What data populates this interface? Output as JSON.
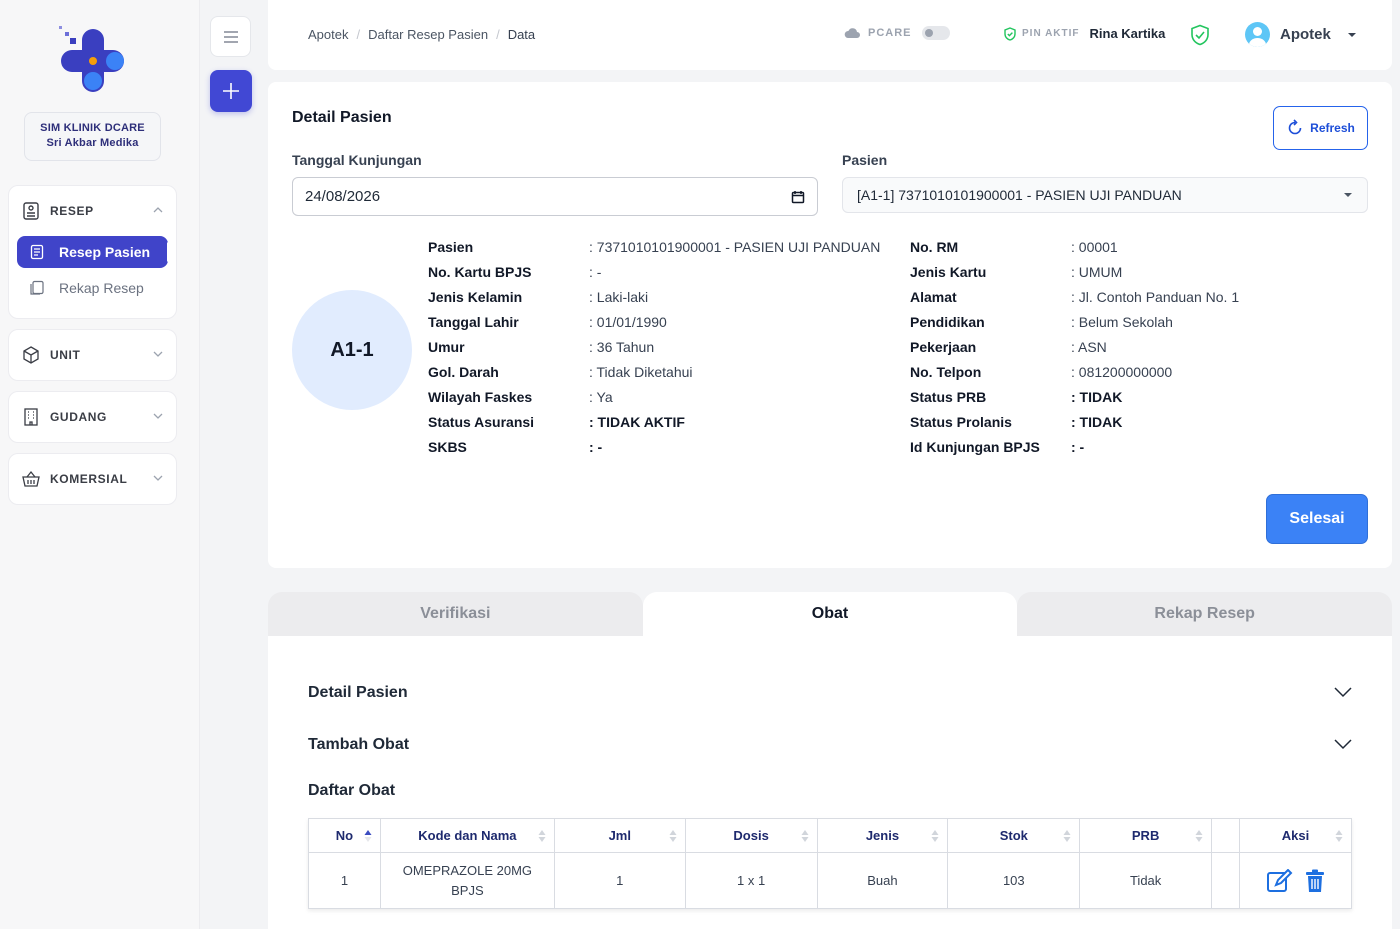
{
  "clinic": {
    "line1": "SIM KLINIK DCARE",
    "line2": "Sri Akbar Medika"
  },
  "sidebar": {
    "resep": {
      "label": "RESEP",
      "items": [
        {
          "label": "Resep Pasien",
          "active": true
        },
        {
          "label": "Rekap Resep",
          "active": false
        }
      ]
    },
    "unit": {
      "label": "UNIT"
    },
    "gudang": {
      "label": "GUDANG"
    },
    "komersial": {
      "label": "KOMERSIAL"
    }
  },
  "breadcrumb": {
    "item1": "Apotek",
    "item2": "Daftar Resep Pasien",
    "item3": "Data"
  },
  "topbar": {
    "pcare_label": "PCARE",
    "pin_label": "PIN AKTIF",
    "pin_name": "Rina Kartika",
    "user_name": "Apotek"
  },
  "detail": {
    "title": "Detail Pasien",
    "refresh_label": "Refresh",
    "tanggal_label": "Tanggal Kunjungan",
    "tanggal_value": "24/08/2026",
    "pasien_label": "Pasien",
    "pasien_value": "[A1-1] 7371010101900001 - PASIEN UJI PANDUAN",
    "queue_code": "A1-1",
    "left": [
      {
        "k": "Pasien",
        "v": ": 7371010101900001 - PASIEN UJI PANDUAN",
        "bold": false
      },
      {
        "k": "No. Kartu BPJS",
        "v": ": -",
        "bold": false
      },
      {
        "k": "Jenis Kelamin",
        "v": ": Laki-laki",
        "bold": false
      },
      {
        "k": "Tanggal Lahir",
        "v": ": 01/01/1990",
        "bold": false
      },
      {
        "k": "Umur",
        "v": ": 36 Tahun",
        "bold": false
      },
      {
        "k": "Gol. Darah",
        "v": ": Tidak Diketahui",
        "bold": false
      },
      {
        "k": "Wilayah Faskes",
        "v": ": Ya",
        "bold": false
      },
      {
        "k": "Status Asuransi",
        "v": ": TIDAK AKTIF",
        "bold": true
      },
      {
        "k": "SKBS",
        "v": ": -",
        "bold": true
      }
    ],
    "right": [
      {
        "k": "No. RM",
        "v": ": 00001",
        "bold": false
      },
      {
        "k": "Jenis Kartu",
        "v": ": UMUM",
        "bold": false
      },
      {
        "k": "Alamat",
        "v": ": Jl. Contoh Panduan No. 1",
        "bold": false
      },
      {
        "k": "Pendidikan",
        "v": ": Belum Sekolah",
        "bold": false
      },
      {
        "k": "Pekerjaan",
        "v": ": ASN",
        "bold": false
      },
      {
        "k": "No. Telpon",
        "v": ": 081200000000",
        "bold": false
      },
      {
        "k": "Status PRB",
        "v": ": TIDAK",
        "bold": true
      },
      {
        "k": "Status Prolanis",
        "v": ": TIDAK",
        "bold": true
      },
      {
        "k": "Id Kunjungan BPJS",
        "v": ": -",
        "bold": true
      }
    ],
    "selesai_label": "Selesai"
  },
  "tabs": [
    {
      "label": "Verifikasi",
      "active": false
    },
    {
      "label": "Obat",
      "active": true
    },
    {
      "label": "Rekap Resep",
      "active": false
    }
  ],
  "obat": {
    "acc1": "Detail Pasien",
    "acc2": "Tambah Obat",
    "list_title": "Daftar Obat",
    "columns": [
      "No",
      "Kode dan Nama",
      "Jml",
      "Dosis",
      "Jenis",
      "Stok",
      "PRB",
      "",
      "Aksi"
    ],
    "rows": [
      {
        "no": "1",
        "nama": "OMEPRAZOLE 20MG BPJS",
        "jml": "1",
        "dosis": "1 x 1",
        "jenis": "Buah",
        "stok": "103",
        "prb": "Tidak"
      }
    ]
  },
  "colors": {
    "primary": "#4044c9",
    "accent_blue": "#3b82f6",
    "success": "#22c55e"
  }
}
